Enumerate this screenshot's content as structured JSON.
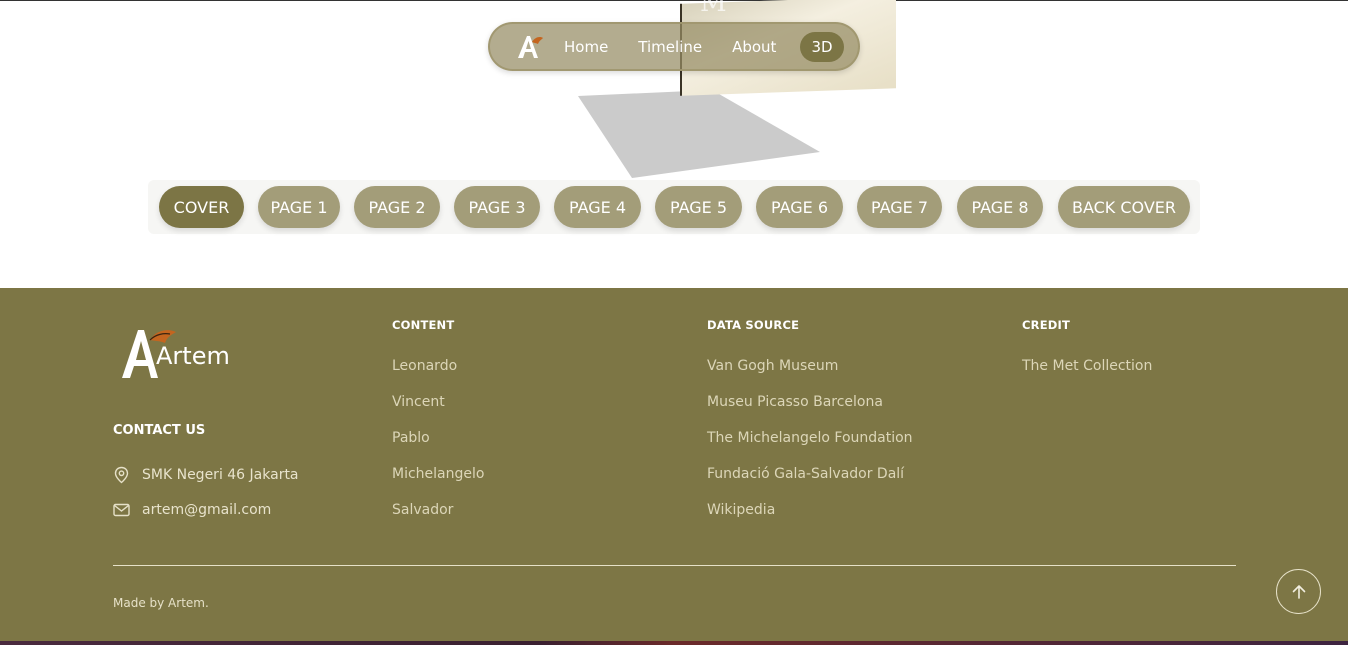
{
  "nav": {
    "links": [
      "Home",
      "Timeline",
      "About"
    ],
    "active_label": "3D"
  },
  "book": {
    "page_letter": "M"
  },
  "pages": [
    "COVER",
    "PAGE 1",
    "PAGE 2",
    "PAGE 3",
    "PAGE 4",
    "PAGE 5",
    "PAGE 6",
    "PAGE 7",
    "PAGE 8",
    "BACK COVER"
  ],
  "footer": {
    "brand": "Artem",
    "contact_title": "CONTACT US",
    "address": "SMK Negeri 46 Jakarta",
    "email": "artem@gmail.com",
    "columns": [
      {
        "title": "CONTENT",
        "items": [
          "Leonardo",
          "Vincent",
          "Pablo",
          "Michelangelo",
          "Salvador"
        ]
      },
      {
        "title": "DATA SOURCE",
        "items": [
          "Van Gogh Museum",
          "Museu Picasso Barcelona",
          "The Michelangelo Foundation",
          "Fundació Gala-Salvador Dalí",
          "Wikipedia"
        ]
      },
      {
        "title": "CREDIT",
        "items": [
          "The Met Collection"
        ]
      }
    ],
    "made_by": "Made by Artem."
  },
  "colors": {
    "olive": "#7d7645",
    "olive_light": "#a39d79",
    "olive_dark": "#7c7545"
  }
}
